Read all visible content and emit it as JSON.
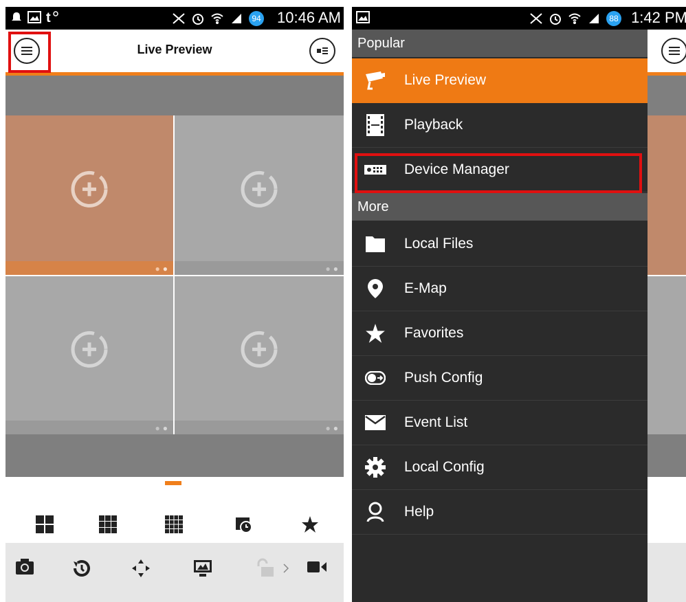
{
  "left_screen": {
    "status_bar": {
      "time": "10:46 AM",
      "battery": "94"
    },
    "title": "Live Preview",
    "menu_icon": "hamburger-circle-icon",
    "device_icon": "device-list-icon",
    "layout_icons": [
      "grid-4-icon",
      "grid-9-icon",
      "grid-16-icon",
      "schedule-icon",
      "star-icon"
    ],
    "toolbar_icons": [
      "camera-icon",
      "history-icon",
      "ptz-arrows-icon",
      "monitor-icon",
      "unlock-icon",
      "video-icon"
    ],
    "accent_color": "#f07f1b"
  },
  "right_screen": {
    "status_bar": {
      "time": "1:42 PM",
      "battery": "88"
    },
    "sections": [
      {
        "header": "Popular",
        "items": [
          {
            "label": "Live Preview",
            "icon": "cctv-camera-icon",
            "active": true
          },
          {
            "label": "Playback",
            "icon": "film-strip-icon"
          },
          {
            "label": "Device Manager",
            "icon": "dvr-device-icon",
            "highlighted": true
          }
        ]
      },
      {
        "header": "More",
        "items": [
          {
            "label": "Local Files",
            "icon": "folder-icon"
          },
          {
            "label": "E-Map",
            "icon": "map-pin-icon"
          },
          {
            "label": "Favorites",
            "icon": "star-icon"
          },
          {
            "label": "Push Config",
            "icon": "toggle-arrow-icon"
          },
          {
            "label": "Event List",
            "icon": "envelope-icon"
          },
          {
            "label": "Local Config",
            "icon": "gear-icon"
          },
          {
            "label": "Help",
            "icon": "person-icon"
          }
        ]
      }
    ],
    "highlight_color": "#e01010"
  }
}
